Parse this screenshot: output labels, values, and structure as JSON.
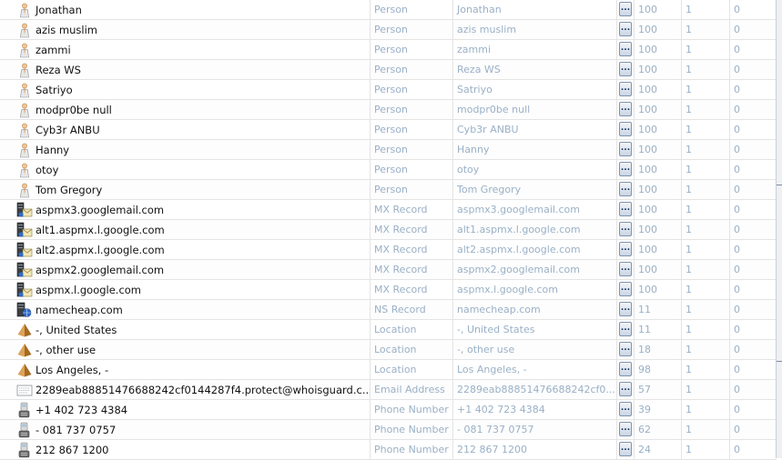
{
  "table": {
    "rows": [
      {
        "name": "Jonathan",
        "type": "Person",
        "value": "Jonathan",
        "icon": "person-icon",
        "weight": "100",
        "b": "1",
        "c": "0"
      },
      {
        "name": "azis muslim",
        "type": "Person",
        "value": "azis muslim",
        "icon": "person-icon",
        "weight": "100",
        "b": "1",
        "c": "0"
      },
      {
        "name": "zammi",
        "type": "Person",
        "value": "zammi",
        "icon": "person-icon",
        "weight": "100",
        "b": "1",
        "c": "0"
      },
      {
        "name": "Reza WS",
        "type": "Person",
        "value": "Reza WS",
        "icon": "person-icon",
        "weight": "100",
        "b": "1",
        "c": "0"
      },
      {
        "name": "Satriyo",
        "type": "Person",
        "value": "Satriyo",
        "icon": "person-icon",
        "weight": "100",
        "b": "1",
        "c": "0"
      },
      {
        "name": "modpr0be null",
        "type": "Person",
        "value": "modpr0be null",
        "icon": "person-icon",
        "weight": "100",
        "b": "1",
        "c": "0"
      },
      {
        "name": "Cyb3r ANBU",
        "type": "Person",
        "value": "Cyb3r ANBU",
        "icon": "person-icon",
        "weight": "100",
        "b": "1",
        "c": "0"
      },
      {
        "name": "Hanny",
        "type": "Person",
        "value": "Hanny",
        "icon": "person-icon",
        "weight": "100",
        "b": "1",
        "c": "0"
      },
      {
        "name": "otoy",
        "type": "Person",
        "value": "otoy",
        "icon": "person-icon",
        "weight": "100",
        "b": "1",
        "c": "0"
      },
      {
        "name": "Tom Gregory",
        "type": "Person",
        "value": "Tom Gregory",
        "icon": "person-icon",
        "weight": "100",
        "b": "1",
        "c": "0"
      },
      {
        "name": "aspmx3.googlemail.com",
        "type": "MX Record",
        "value": "aspmx3.googlemail.com",
        "icon": "mx-record-icon",
        "weight": "100",
        "b": "1",
        "c": "0"
      },
      {
        "name": "alt1.aspmx.l.google.com",
        "type": "MX Record",
        "value": "alt1.aspmx.l.google.com",
        "icon": "mx-record-icon",
        "weight": "100",
        "b": "1",
        "c": "0"
      },
      {
        "name": "alt2.aspmx.l.google.com",
        "type": "MX Record",
        "value": "alt2.aspmx.l.google.com",
        "icon": "mx-record-icon",
        "weight": "100",
        "b": "1",
        "c": "0"
      },
      {
        "name": "aspmx2.googlemail.com",
        "type": "MX Record",
        "value": "aspmx2.googlemail.com",
        "icon": "mx-record-icon",
        "weight": "100",
        "b": "1",
        "c": "0"
      },
      {
        "name": "aspmx.l.google.com",
        "type": "MX Record",
        "value": "aspmx.l.google.com",
        "icon": "mx-record-icon",
        "weight": "100",
        "b": "1",
        "c": "0"
      },
      {
        "name": "namecheap.com",
        "type": "NS Record",
        "value": "namecheap.com",
        "icon": "ns-record-icon",
        "weight": "11",
        "b": "1",
        "c": "0"
      },
      {
        "name": "-, United States",
        "type": "Location",
        "value": "-, United States",
        "icon": "location-pyramid-icon",
        "weight": "11",
        "b": "1",
        "c": "0"
      },
      {
        "name": "-, other use",
        "type": "Location",
        "value": "-, other use",
        "icon": "location-pyramid-icon",
        "weight": "18",
        "b": "1",
        "c": "0"
      },
      {
        "name": "Los Angeles, -",
        "type": "Location",
        "value": "Los Angeles, -",
        "icon": "location-pyramid-icon",
        "weight": "98",
        "b": "1",
        "c": "0"
      },
      {
        "name": "2289eab88851476688242cf0144287f4.protect@whoisguard.c...",
        "type": "Email Address",
        "value": "2289eab88851476688242cf0...",
        "icon": "email-address-icon",
        "weight": "57",
        "b": "1",
        "c": "0"
      },
      {
        "name": "+1 402 723 4384",
        "type": "Phone Number",
        "value": "+1 402 723 4384",
        "icon": "phone-icon",
        "weight": "39",
        "b": "1",
        "c": "0"
      },
      {
        "name": "- 081 737 0757",
        "type": "Phone Number",
        "value": "- 081 737 0757",
        "icon": "phone-icon",
        "weight": "62",
        "b": "1",
        "c": "0"
      },
      {
        "name": "212 867 1200",
        "type": "Phone Number",
        "value": "212 867 1200",
        "icon": "phone-icon",
        "weight": "24",
        "b": "1",
        "c": "0"
      }
    ],
    "edit_button_label": "..."
  }
}
